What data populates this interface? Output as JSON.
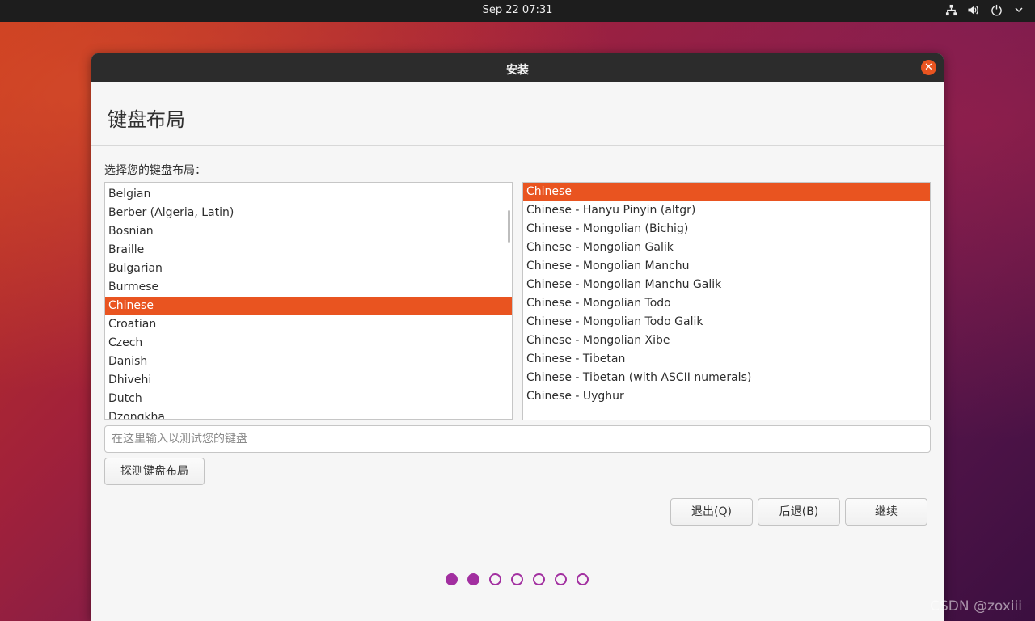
{
  "topbar": {
    "clock": "Sep 22  07:31",
    "icons": [
      "network-icon",
      "volume-icon",
      "power-icon",
      "chevron-down-icon"
    ]
  },
  "window": {
    "title": "安装",
    "page_title": "键盘布局",
    "prompt": "选择您的键盘布局：",
    "layouts": [
      "Belgian",
      "Berber (Algeria, Latin)",
      "Bosnian",
      "Braille",
      "Bulgarian",
      "Burmese",
      "Chinese",
      "Croatian",
      "Czech",
      "Danish",
      "Dhivehi",
      "Dutch",
      "Dzongkha"
    ],
    "selected_layout": "Chinese",
    "variants": [
      "Chinese",
      "Chinese - Hanyu Pinyin (altgr)",
      "Chinese - Mongolian (Bichig)",
      "Chinese - Mongolian Galik",
      "Chinese - Mongolian Manchu",
      "Chinese - Mongolian Manchu Galik",
      "Chinese - Mongolian Todo",
      "Chinese - Mongolian Todo Galik",
      "Chinese - Mongolian Xibe",
      "Chinese - Tibetan",
      "Chinese - Tibetan (with ASCII numerals)",
      "Chinese - Uyghur"
    ],
    "selected_variant": "Chinese",
    "test_placeholder": "在这里输入以测试您的键盘",
    "detect_button": "探测键盘布局",
    "quit_button": "退出(Q)",
    "back_button": "后退(B)",
    "continue_button": "继续",
    "progress": {
      "total": 7,
      "completed": 2
    }
  },
  "colors": {
    "accent": "#e95420",
    "progress_dot": "#a22fa0"
  },
  "watermark": "CSDN @zoxiii"
}
